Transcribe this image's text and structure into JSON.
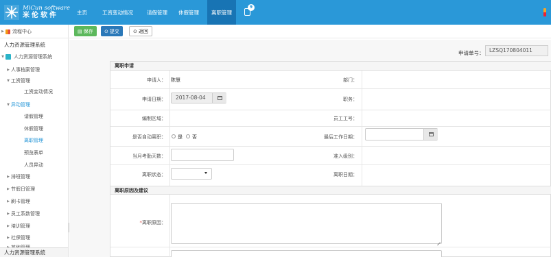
{
  "app": {
    "logo_en": "MiCun software",
    "logo_cn": "米伦软件",
    "brand_color": "#2a98d8",
    "notification_count": "9"
  },
  "nav": {
    "items": [
      {
        "label": "主页"
      },
      {
        "label": "工资变动情况"
      },
      {
        "label": "请假管理"
      },
      {
        "label": "休假管理"
      },
      {
        "label": "离职管理"
      }
    ],
    "active_index": 4
  },
  "toolbar": {
    "save_label": "保存",
    "submit_label": "提交",
    "back_label": "返回"
  },
  "sidebar": {
    "process_center": "流程中心",
    "system_title": "人力资源管理系统",
    "root": "人力资源管理系统",
    "items": [
      {
        "label": "人事档案管理"
      },
      {
        "label": "工资管理"
      },
      {
        "label": "工资变动情况"
      },
      {
        "label": "异动管理"
      },
      {
        "label": "请假管理"
      },
      {
        "label": "休假管理"
      },
      {
        "label": "离职管理"
      },
      {
        "label": "预览表单"
      },
      {
        "label": "人员异动"
      },
      {
        "label": "排班管理"
      },
      {
        "label": "节假日管理"
      },
      {
        "label": "刷卡管理"
      },
      {
        "label": "员工系数管理"
      },
      {
        "label": "培训管理"
      },
      {
        "label": "社保管理"
      },
      {
        "label": "其他管理"
      }
    ],
    "footer": "人力资源管理系统"
  },
  "form": {
    "apply_no_label": "申请单号：",
    "apply_no": "LZSQ170804011",
    "section1_title": "离职申请",
    "section2_title": "离职原因及建议",
    "applicant_label": "申请人：",
    "applicant_value": "陈慧",
    "department_label": "部门：",
    "apply_date_label": "申请日期：",
    "apply_date_value": "2017-08-04",
    "position_label": "职务：",
    "staffing_label": "编制区域：",
    "employee_no_label": "员工工号：",
    "auto_leave_label": "是否自动离职：",
    "radio_yes": "是",
    "radio_no": "否",
    "last_workday_label": "最后工作日期：",
    "month_attendance_label": "当月考勤天数：",
    "approve_level_label": "准入级别：",
    "leave_status_label": "离职状态：",
    "leave_date_label": "离职日期：",
    "reason_label": "离职原因："
  }
}
